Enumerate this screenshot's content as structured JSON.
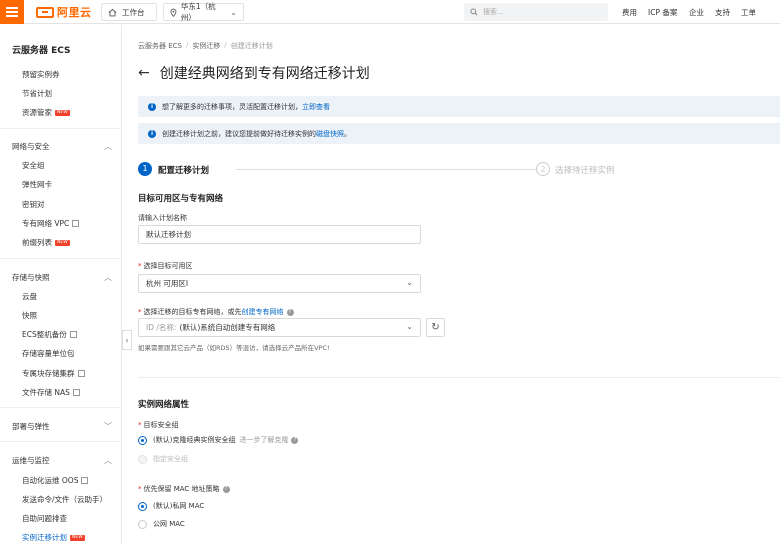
{
  "topbar": {
    "logo_text": "阿里云",
    "workbench_label": "工作台",
    "region_label": "华东1（杭州）",
    "search_placeholder": "搜索...",
    "nav": [
      "费用",
      "ICP 备案",
      "企业",
      "支持",
      "工单"
    ]
  },
  "sidebar": {
    "title": "云服务器 ECS",
    "top_items": [
      {
        "label": "预留实例券"
      },
      {
        "label": "节省计划"
      },
      {
        "label": "资源管家",
        "badge": "NEW"
      }
    ],
    "groups": [
      {
        "label": "网络与安全",
        "items": [
          "安全组",
          "弹性网卡",
          "密钥对",
          "专有网络 VPC",
          "前缀列表"
        ]
      },
      {
        "label": "存储与快照",
        "items": [
          "云盘",
          "快照",
          "ECS整机备份",
          "存储容量单位包",
          "专属块存储集群",
          "文件存储 NAS"
        ]
      },
      {
        "label": "部署与弹性",
        "items": []
      },
      {
        "label": "运维与监控",
        "items": [
          "自动化运维 OOS",
          "发送命令/文件（云助手）",
          "自助问题排查",
          "实例迁移计划"
        ]
      }
    ],
    "badge_new": "NEW"
  },
  "breadcrumb": [
    "云服务器 ECS",
    "实例迁移",
    "创建迁移计划"
  ],
  "page_title": "创建经典网络到专有网络迁移计划",
  "notices": [
    {
      "text": "想了解更多的迁移事项，灵活配置迁移计划，",
      "link": "立即查看"
    },
    {
      "text": "创建迁移计划之前，建议您提前做好待迁移实例的",
      "link": "磁盘快照",
      "suffix": "。"
    }
  ],
  "steps": [
    {
      "num": "1",
      "label": "配置迁移计划",
      "active": true
    },
    {
      "num": "2",
      "label": "选择待迁移实例",
      "active": false
    }
  ],
  "section1": {
    "title": "目标可用区与专有网络",
    "plan_name_label": "请输入计划名称",
    "plan_name_value": "默认迁移计划",
    "zone_label": "选择目标可用区",
    "zone_value": "杭州 可用区I",
    "vpc_label": "选择迁移的目标专有网络，或先",
    "vpc_label_link": "创建专有网络",
    "vpc_prefix": "ID /名称:",
    "vpc_value": "(默认)系统自动创建专有网络",
    "hint": "如果需要跟其它云产品（如RDS）等混访，请选择云产品所在VPC!"
  },
  "section2": {
    "title": "实例网络属性",
    "sg_label": "目标安全组",
    "sg_option1": "(默认)克隆经典实例安全组",
    "sg_option1_link": "进一步了解克隆",
    "sg_option2": "指定安全组",
    "mac_label": "优先保留 MAC 地址策略",
    "mac_option1": "(默认)私网 MAC",
    "mac_option2": "公网 MAC"
  },
  "colors": {
    "brand": "#ff6a00",
    "primary": "#0064c8",
    "notice_bg": "#ecf2f8",
    "required": "#e02020"
  }
}
